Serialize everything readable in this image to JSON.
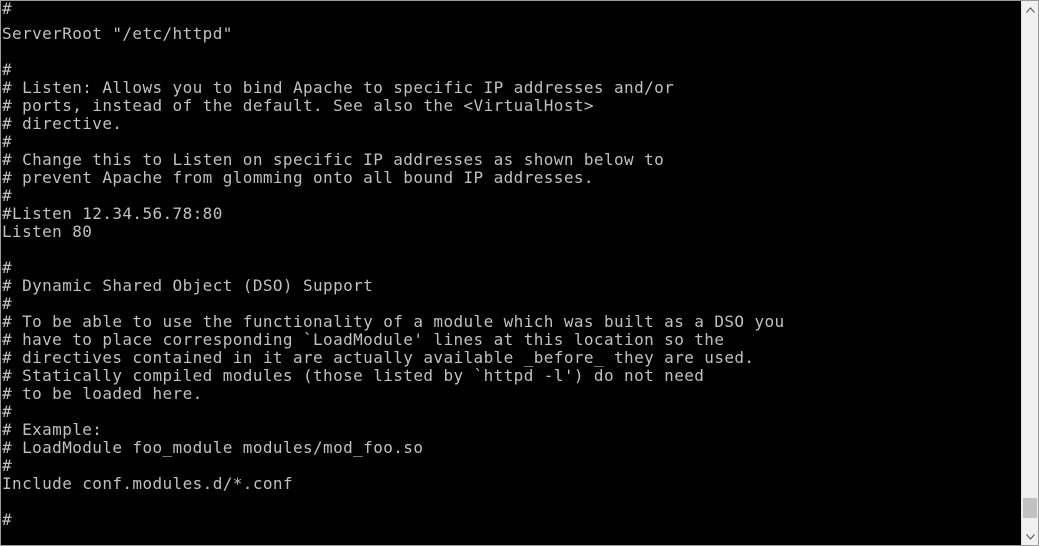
{
  "terminal": {
    "lines": [
      "#",
      "ServerRoot \"/etc/httpd\"",
      "",
      "#",
      "# Listen: Allows you to bind Apache to specific IP addresses and/or",
      "# ports, instead of the default. See also the <VirtualHost>",
      "# directive.",
      "#",
      "# Change this to Listen on specific IP addresses as shown below to",
      "# prevent Apache from glomming onto all bound IP addresses.",
      "#",
      "#Listen 12.34.56.78:80",
      "Listen 80",
      "",
      "#",
      "# Dynamic Shared Object (DSO) Support",
      "#",
      "# To be able to use the functionality of a module which was built as a DSO you",
      "# have to place corresponding `LoadModule' lines at this location so the",
      "# directives contained in it are actually available _before_ they are used.",
      "# Statically compiled modules (those listed by `httpd -l') do not need",
      "# to be loaded here.",
      "#",
      "# Example:",
      "# LoadModule foo_module modules/mod_foo.so",
      "#",
      "Include conf.modules.d/*.conf",
      "",
      "#"
    ],
    "text_color": "#c0c0c0",
    "background_color": "#000000"
  },
  "scrollbar": {
    "up_icon": "arrow-up-icon",
    "down_icon": "arrow-down-icon",
    "position_fraction": 0.98
  }
}
